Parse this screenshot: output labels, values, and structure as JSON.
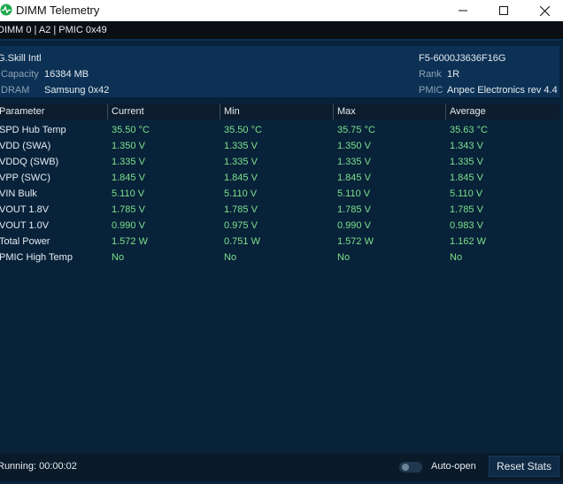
{
  "window": {
    "title": "DIMM Telemetry",
    "icon": "pulse-icon",
    "minimize_icon": "minimize-icon",
    "maximize_icon": "maximize-icon",
    "close_icon": "close-icon"
  },
  "subheader": {
    "text": "DIMM 0 | A2 | PMIC 0x49"
  },
  "info": {
    "vendor": "G.Skill Intl",
    "part_number": "F5-6000J3636F16G",
    "capacity_label": "Capacity",
    "capacity_value": "16384 MB",
    "rank_label": "Rank",
    "rank_value": "1R",
    "dram_label": "DRAM",
    "dram_value": "Samsung 0x42",
    "pmic_label": "PMIC",
    "pmic_value": "Anpec Electronics rev 4.4"
  },
  "table": {
    "headers": [
      "Parameter",
      "Current",
      "Min",
      "Max",
      "Average"
    ],
    "rows": [
      [
        "SPD Hub Temp",
        "35.50 °C",
        "35.50 °C",
        "35.75 °C",
        "35.63 °C"
      ],
      [
        "VDD (SWA)",
        "1.350 V",
        "1.335 V",
        "1.350 V",
        "1.343 V"
      ],
      [
        "VDDQ (SWB)",
        "1.335 V",
        "1.335 V",
        "1.335 V",
        "1.335 V"
      ],
      [
        "VPP (SWC)",
        "1.845 V",
        "1.845 V",
        "1.845 V",
        "1.845 V"
      ],
      [
        "VIN Bulk",
        "5.110 V",
        "5.110 V",
        "5.110 V",
        "5.110 V"
      ],
      [
        "VOUT 1.8V",
        "1.785 V",
        "1.785 V",
        "1.785 V",
        "1.785 V"
      ],
      [
        "VOUT 1.0V",
        "0.990 V",
        "0.975 V",
        "0.990 V",
        "0.983 V"
      ],
      [
        "Total Power",
        "1.572 W",
        "0.751 W",
        "1.572 W",
        "1.162 W"
      ],
      [
        "PMIC High Temp",
        "No",
        "No",
        "No",
        "No"
      ]
    ]
  },
  "status": {
    "running": "Running: 00:00:02",
    "auto_open_label": "Auto-open",
    "auto_open_on": false,
    "reset_label": "Reset Stats"
  },
  "colors": {
    "background": "#08223a",
    "value_green": "#7ee08a",
    "muted": "#8ea2b5"
  }
}
